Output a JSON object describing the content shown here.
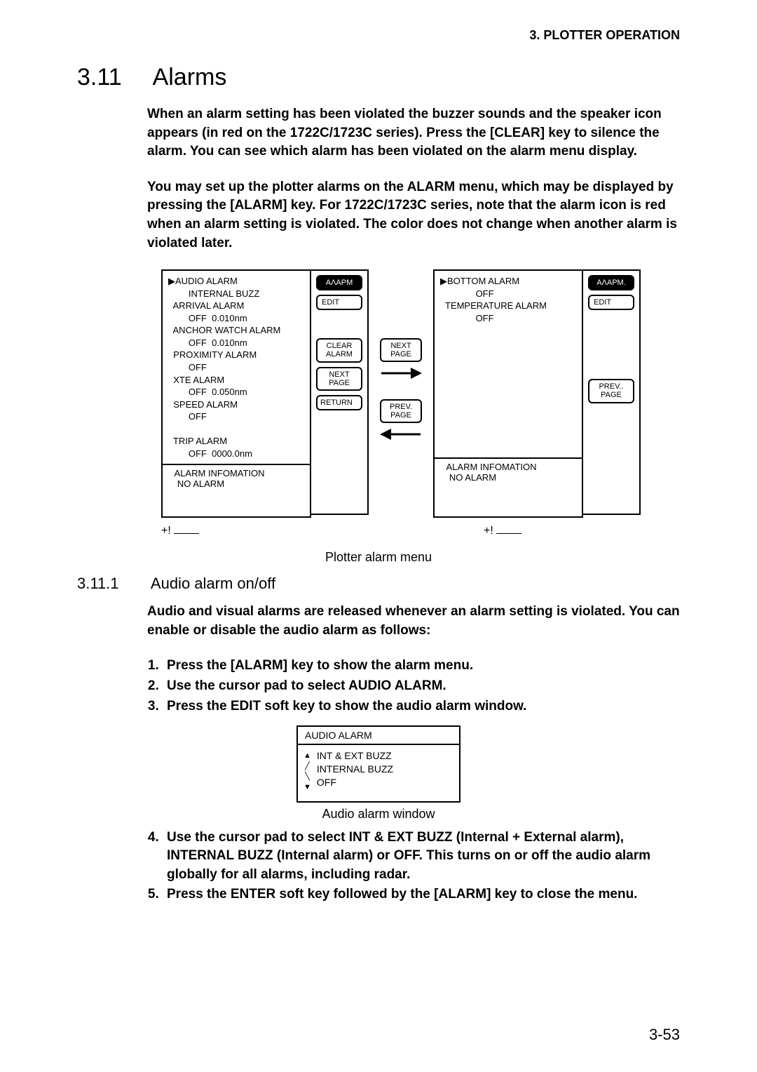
{
  "header": "3. PLOTTER OPERATION",
  "section": {
    "number": "3.11",
    "title": "Alarms"
  },
  "para1": "When an alarm setting has been violated the buzzer sounds and the speaker icon appears (in red on the 1722C/1723C series). Press the [CLEAR] key to silence the alarm. You can see which alarm has been violated on the alarm menu display.",
  "para2": "You may set up the plotter alarms on the ALARM menu, which may be displayed by pressing the [ALARM] key. For 1722C/1723C series, note that the alarm icon is red when an alarm setting is violated. The color does not change when another alarm is violated later.",
  "menu1": {
    "body": "▶AUDIO ALARM\n        INTERNAL BUZZ\n  ARRIVAL ALARM\n        OFF  0.010nm\n  ANCHOR WATCH ALARM\n        OFF  0.010nm\n  PROXIMITY ALARM\n        OFF\n  XTE ALARM\n        OFF  0.050nm\n  SPEED ALARM\n        OFF\n\n  TRIP ALARM\n        OFF  0000.0nm",
    "info": "  ALARM INFOMATION\n   NO ALARM",
    "soft": {
      "k1": "ΑΛΑΡΜ",
      "k2": "EDIT",
      "k3": "CLEAR\nALARM",
      "k4": "NEXT\nPAGE",
      "k5": "RETURN"
    }
  },
  "nav": {
    "next": "NEXT\nPAGE",
    "prev": "PREV.\nPAGE"
  },
  "menu2": {
    "body": "▶BOTTOM ALARM\n              OFF\n  TEMPERATURE ALARM\n              OFF",
    "info": "  ALARM INFOMATION\n   NO ALARM",
    "soft": {
      "k1": "ΑΛΑΡΜ.",
      "k2": "EDIT",
      "k4": "PREV..\nPAGE"
    }
  },
  "plus": "+!",
  "figcap1": "Plotter alarm menu",
  "sub": {
    "number": "3.11.1",
    "title": "Audio alarm on/off"
  },
  "para3": "Audio and visual alarms are released whenever an alarm setting is violated. You can enable or disable the audio alarm as follows:",
  "steps_a": [
    "Press the [ALARM] key to show the alarm menu.",
    "Use the cursor pad to select AUDIO ALARM.",
    "Press the EDIT soft key to show the audio alarm window."
  ],
  "aw": {
    "title": "AUDIO ALARM",
    "options": "INT & EXT BUZZ\nINTERNAL BUZZ\nOFF"
  },
  "figcap2": "Audio alarm window",
  "steps_b": [
    "Use the cursor pad to select INT & EXT BUZZ (Internal + External alarm), INTERNAL BUZZ (Internal alarm) or OFF. This turns on or off the audio alarm globally for all alarms, including radar.",
    "Press the ENTER soft key followed by the [ALARM] key to close the menu."
  ],
  "pagenum": "3-53"
}
